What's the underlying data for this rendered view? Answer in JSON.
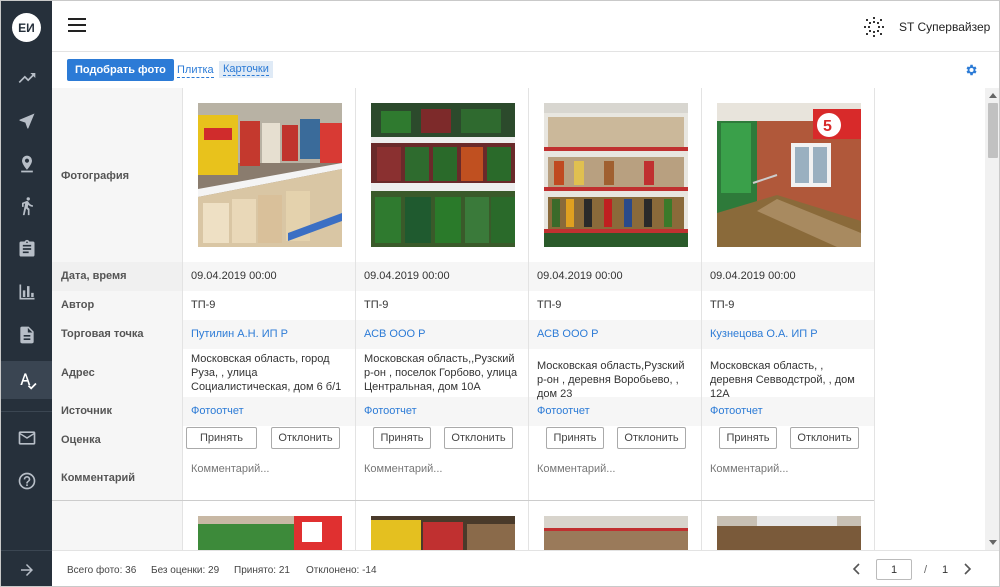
{
  "app": {
    "avatar_initials": "ЕИ",
    "user_name": "ST Супервайзер"
  },
  "sidebar": {
    "items": [
      {
        "icon": "trending-up-icon"
      },
      {
        "icon": "navigation-arrow-icon"
      },
      {
        "icon": "location-pin-icon"
      },
      {
        "icon": "walking-person-icon"
      },
      {
        "icon": "clipboard-icon"
      },
      {
        "icon": "bar-chart-icon"
      },
      {
        "icon": "document-icon"
      },
      {
        "icon": "photo-check-icon",
        "active": true
      },
      {
        "icon": "mail-icon"
      },
      {
        "icon": "help-icon"
      }
    ],
    "collapse_icon": "arrow-right-icon"
  },
  "toolbar": {
    "primary_button": "Подобрать фото",
    "view_tile": "Плитка",
    "view_cards": "Карточки",
    "active_view": "Карточки"
  },
  "labels": {
    "photo": "Фотография",
    "datetime": "Дата, время",
    "author": "Автор",
    "outlet": "Торговая точка",
    "address": "Адрес",
    "source": "Источник",
    "rating": "Оценка",
    "comment": "Комментарий"
  },
  "cards": [
    {
      "datetime": "09.04.2019 00:00",
      "author": "ТП-9",
      "outlet": "Путилин А.Н. ИП Р",
      "address": "Московская область, город Руза, , улица Социалистическая, дом 6 б/1",
      "source": "Фотоотчет",
      "accept": "Принять",
      "reject": "Отклонить",
      "comment_placeholder": "Комментарий..."
    },
    {
      "datetime": "09.04.2019 00:00",
      "author": "ТП-9",
      "outlet": "АСВ ООО Р",
      "address": "Московская область,,Рузский р-он , поселок Горбово, улица Центральная, дом 10А",
      "source": "Фотоотчет",
      "accept": "Принять",
      "reject": "Отклонить",
      "comment_placeholder": "Комментарий..."
    },
    {
      "datetime": "09.04.2019 00:00",
      "author": "ТП-9",
      "outlet": "АСВ ООО Р",
      "address": "Московская область,Рузский р-он , деревня Воробьево, , дом 23",
      "source": "Фотоотчет",
      "accept": "Принять",
      "reject": "Отклонить",
      "comment_placeholder": "Комментарий..."
    },
    {
      "datetime": "09.04.2019 00:00",
      "author": "ТП-9",
      "outlet": "Кузнецова О.А. ИП Р",
      "address": "Московская область, , деревня Севводстрой, , дом 12А",
      "source": "Фотоотчет",
      "accept": "Принять",
      "reject": "Отклонить",
      "comment_placeholder": "Комментарий..."
    }
  ],
  "footer": {
    "total": "Всего фото: 36",
    "unrated": "Без оценки: 29",
    "accepted": "Принято: 21",
    "rejected": "Отклонено: -14",
    "current_page": "1",
    "page_sep": "/",
    "total_pages": "1"
  }
}
